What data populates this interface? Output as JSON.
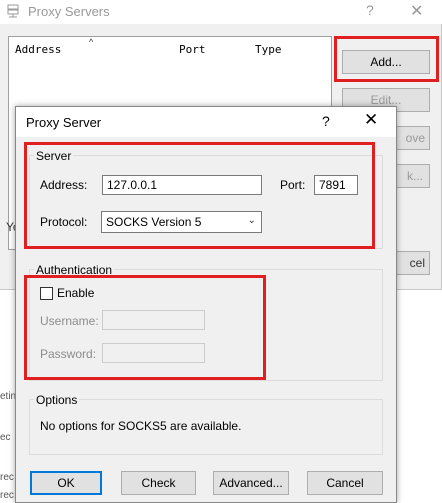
{
  "background_window": {
    "title": "Proxy Servers",
    "help_glyph": "?",
    "close_glyph": "✕",
    "columns": [
      "Address",
      "Port",
      "Type"
    ],
    "sort_glyph": "^",
    "buttons": {
      "add": "Add...",
      "edit": "Edit...",
      "remove": "ove",
      "other": "k..."
    },
    "left_text": "Yo",
    "cancel_fragment": "cel",
    "edge_fragments": [
      "etin",
      "ec",
      "rec",
      "rec"
    ]
  },
  "dialog": {
    "title": "Proxy Server",
    "help_glyph": "?",
    "close_glyph": "✕",
    "server": {
      "legend": "Server",
      "address_label": "Address:",
      "address_value": "127.0.0.1",
      "port_label": "Port:",
      "port_value": "7891",
      "protocol_label": "Protocol:",
      "protocol_value": "SOCKS Version 5",
      "chevron": "⌄"
    },
    "authentication": {
      "legend": "Authentication",
      "enable_label": "Enable",
      "username_label": "Username:",
      "password_label": "Password:"
    },
    "options": {
      "legend": "Options",
      "message": "No options for SOCKS5 are available."
    },
    "buttons": {
      "ok": "OK",
      "check": "Check",
      "advanced": "Advanced...",
      "cancel": "Cancel"
    }
  },
  "colors": {
    "highlight": "#e02020",
    "dialog_bg": "#f0f0f0",
    "default_button_border": "#0078d7"
  }
}
